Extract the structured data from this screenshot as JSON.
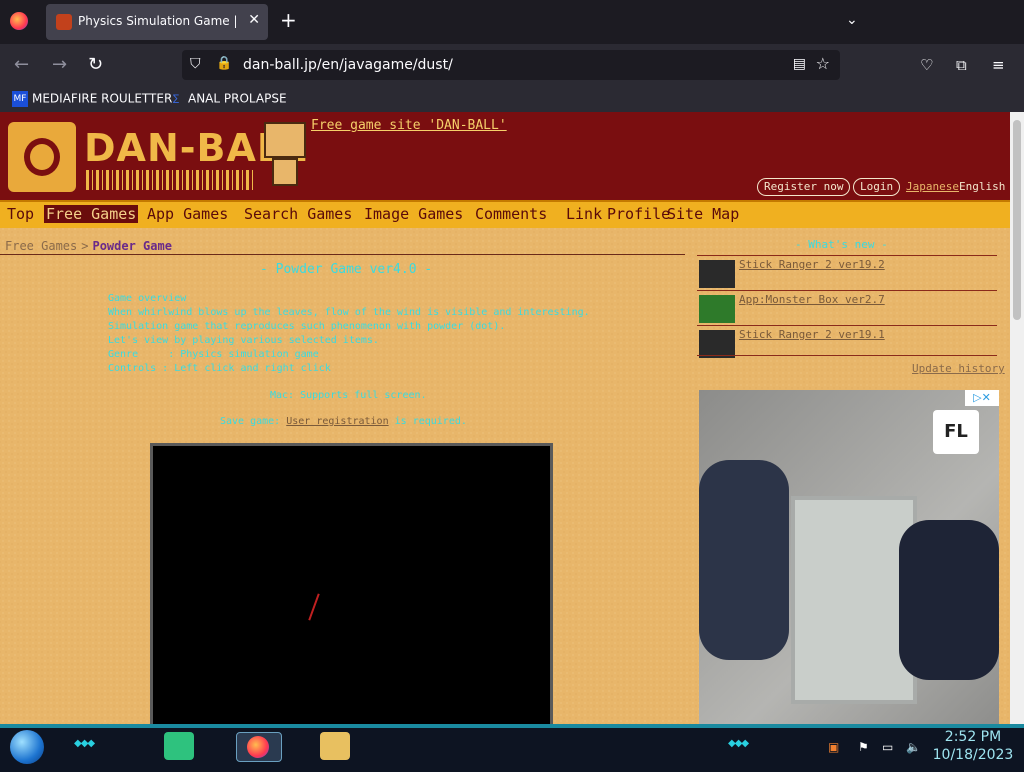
{
  "browser": {
    "tab_title": "Physics Simulation Game | Pow",
    "tab_close": "✕",
    "new_tab": "+",
    "tab_list": "⌄",
    "url": "dan-ball.jp/en/javagame/dust/"
  },
  "bookmarks": [
    {
      "label": "MEDIAFIRE ROULETTER",
      "icon": "MF"
    },
    {
      "label": "ANAL PROLAPSE",
      "icon": "∑"
    }
  ],
  "site": {
    "logo": "DAN-BALL",
    "free_site": "Free game site 'DAN-BALL'",
    "register": "Register now",
    "login": "Login",
    "japanese": "Japanese",
    "english": "English"
  },
  "menu": [
    {
      "label": "Top"
    },
    {
      "label": "Free Games",
      "active": true
    },
    {
      "label": "App Games"
    },
    {
      "label": "Search Games"
    },
    {
      "label": "Image Games"
    },
    {
      "label": "Comments"
    },
    {
      "label": "Link"
    },
    {
      "label": "Profile"
    },
    {
      "label": "Site Map"
    }
  ],
  "breadcrumb": {
    "parent": "Free Games",
    "separator": ">",
    "current": "Powder Game"
  },
  "game": {
    "title": "- Powder Game ver4.0 -",
    "overview": "Game overview\nWhen whirlwind blows up the leaves, flow of the wind is visible and interesting.\nSimulation game that reproduces such phenomenon with powder (dot).\nLet's view by playing various selected items.\nGenre     : Physics simulation game\nControls : Left click and right click",
    "fullscreen": "Mac: Supports full screen.",
    "save_label": "Save game:",
    "save_link": "User registration",
    "save_suffix": "is required."
  },
  "sidebar": {
    "whats_new": "- What's new -",
    "news": [
      {
        "label": "Stick Ranger 2 ver19.2"
      },
      {
        "label": "App:Monster Box ver2.7"
      },
      {
        "label": "Stick Ranger 2 ver19.1"
      }
    ],
    "update_history": "Update history"
  },
  "ad": {
    "logo": "FL",
    "choices": "▷✕"
  },
  "taskbar": {
    "time": "2:52 PM",
    "date": "10/18/2023"
  },
  "colors": {
    "header": "#7a0e10",
    "menubar": "#f0b020",
    "page_bg": "#e8b66a",
    "accent_text": "#3adbe0"
  }
}
